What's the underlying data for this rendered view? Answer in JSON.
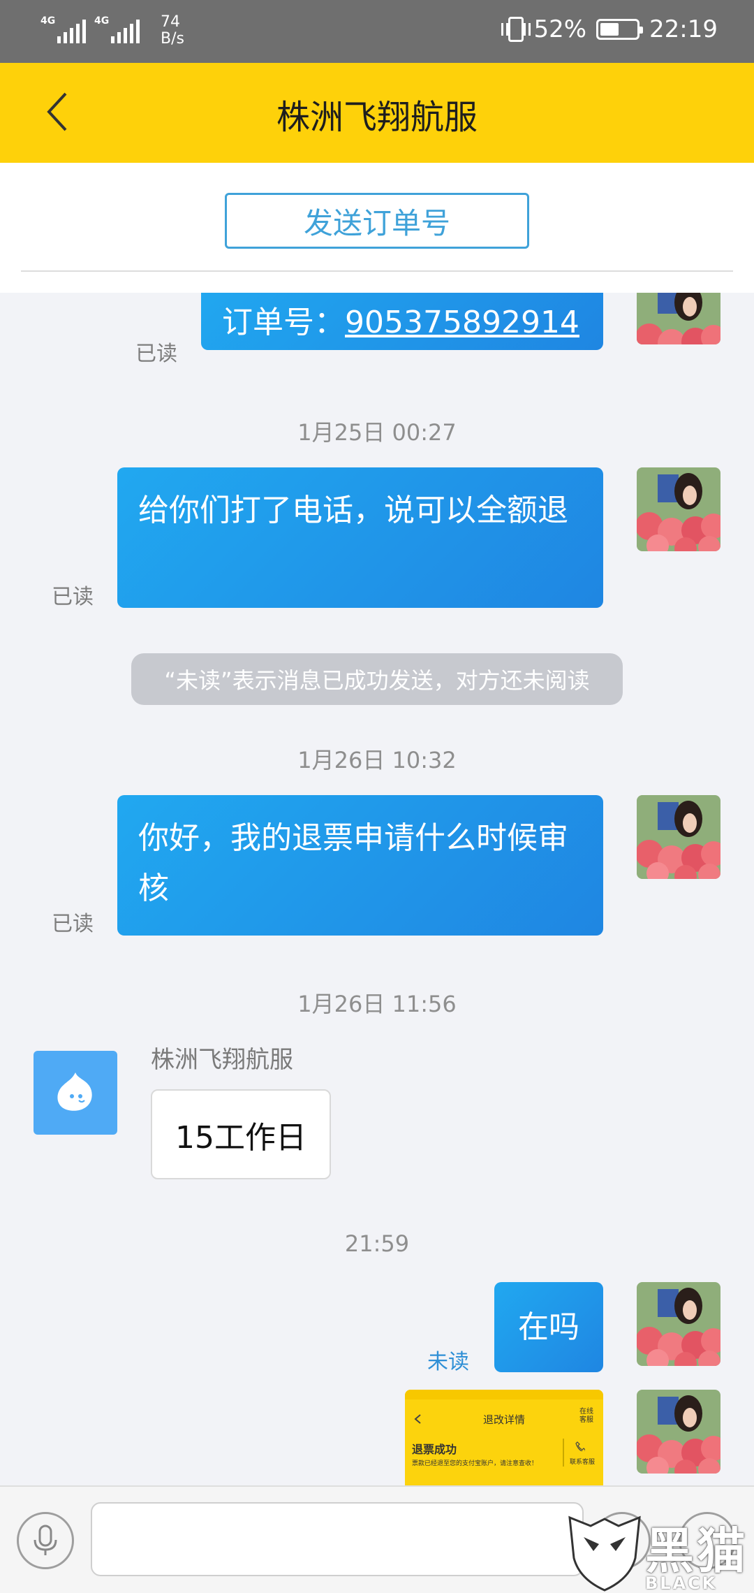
{
  "status_bar": {
    "net1": "4G",
    "net2": "4G",
    "speed_value": "74",
    "speed_unit": "B/s",
    "battery": "52%",
    "battery_level": 0.52,
    "time": "22:19"
  },
  "header": {
    "title": "株洲飞翔航服"
  },
  "order_button": {
    "label": "发送订单号"
  },
  "chat": {
    "msg1": {
      "prefix": "订单号：",
      "order_no": "905375892914",
      "status": "已读"
    },
    "time1": "1月25日 00:27",
    "msg2": {
      "text": "给你们打了电话，说可以全额退",
      "status": "已读"
    },
    "notice": "“未读”表示消息已成功发送，对方还未阅读",
    "time2": "1月26日 10:32",
    "msg3": {
      "text": "你好，我的退票申请什么时候审核",
      "status": "已读"
    },
    "time3": "1月26日 11:56",
    "sender_name": "株洲飞翔航服",
    "reply": "15工作日",
    "time4": "21:59",
    "msg4": {
      "text": "在吗",
      "status": "未读"
    },
    "thumb": {
      "title": "退改详情",
      "status": "退票成功",
      "desc": "票款已经退至您的支付宝账户，请注意查收！",
      "side1": "在线客服",
      "side2": "联系客服"
    }
  },
  "input_bar": {
    "placeholder": ""
  },
  "watermark": {
    "cn": "黑猫",
    "en": "BLACK CAT"
  },
  "colors": {
    "header_bg": "#fed10a",
    "bubble_out": "#1f96e8",
    "accent": "#3fa2d9",
    "status_bar": "#6f6f6f"
  }
}
